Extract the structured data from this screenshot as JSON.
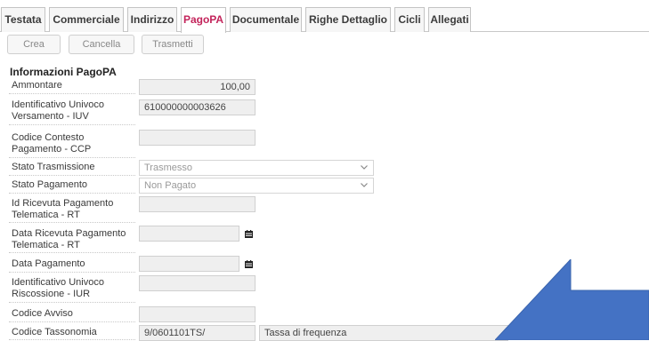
{
  "tabs": [
    {
      "label": "Testata"
    },
    {
      "label": "Commerciale"
    },
    {
      "label": "Indirizzo"
    },
    {
      "label": "PagoPA",
      "active": true
    },
    {
      "label": "Documentale"
    },
    {
      "label": "Righe Dettaglio"
    },
    {
      "label": "Cicli"
    },
    {
      "label": "Allegati"
    }
  ],
  "toolbar": {
    "create_label": "Crea",
    "delete_label": "Cancella",
    "transmit_label": "Trasmetti"
  },
  "section": {
    "title": "Informazioni PagoPA"
  },
  "form": {
    "amount": {
      "label": "Ammontare",
      "value": "100,00"
    },
    "iuv": {
      "label_1": "Identificativo Univoco",
      "label_2": "Versamento - IUV",
      "value": "610000000003626"
    },
    "ccp": {
      "label_1": "Codice Contesto",
      "label_2": "Pagamento - CCP",
      "value": ""
    },
    "transmission_status": {
      "label": "Stato Trasmissione",
      "value": "Trasmesso"
    },
    "payment_status": {
      "label": "Stato Pagamento",
      "value": "Non Pagato"
    },
    "rt_id": {
      "label_1": "Id Ricevuta Pagamento",
      "label_2": "Telematica - RT",
      "value": ""
    },
    "rt_date": {
      "label_1": "Data Ricevuta Pagamento",
      "label_2": "Telematica - RT",
      "value": ""
    },
    "payment_date": {
      "label": "Data Pagamento",
      "value": ""
    },
    "iur": {
      "label_1": "Identificativo Univoco",
      "label_2": "Riscossione - IUR",
      "value": ""
    },
    "notice_code": {
      "label": "Codice Avviso",
      "value": ""
    },
    "taxonomy": {
      "label": "Codice Tassonomia",
      "code": "9/0601101TS/",
      "description": "Tassa di frequenza"
    }
  },
  "colors": {
    "active_tab": "#c3245b",
    "arrow": "#4472c4"
  },
  "icons": {
    "calendar": "calendar-icon",
    "dropdown": "chevron-down-icon"
  }
}
